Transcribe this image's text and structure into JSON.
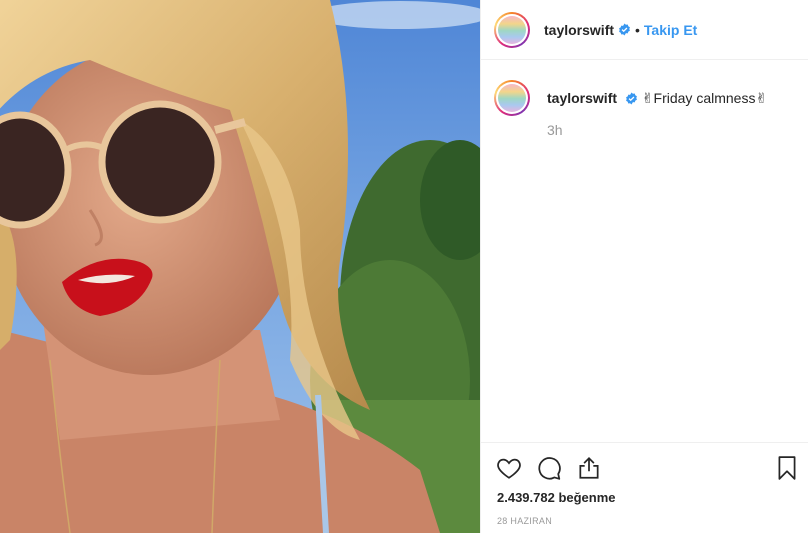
{
  "post": {
    "username": "taylorswift",
    "verified": true,
    "follow_label": "Takip Et",
    "separator": "•",
    "caption": "✌Friday calmness✌",
    "time_ago": "3h",
    "likes": "2.439.782 beğenme",
    "date": "28 HAZIRAN"
  },
  "icons": {
    "like": "heart-icon",
    "comment": "comment-icon",
    "share": "share-icon",
    "save": "bookmark-icon",
    "verified": "verified-badge-icon"
  },
  "colors": {
    "accent": "#3897f0",
    "text": "#262626",
    "muted": "#999999",
    "border": "#efefef"
  }
}
